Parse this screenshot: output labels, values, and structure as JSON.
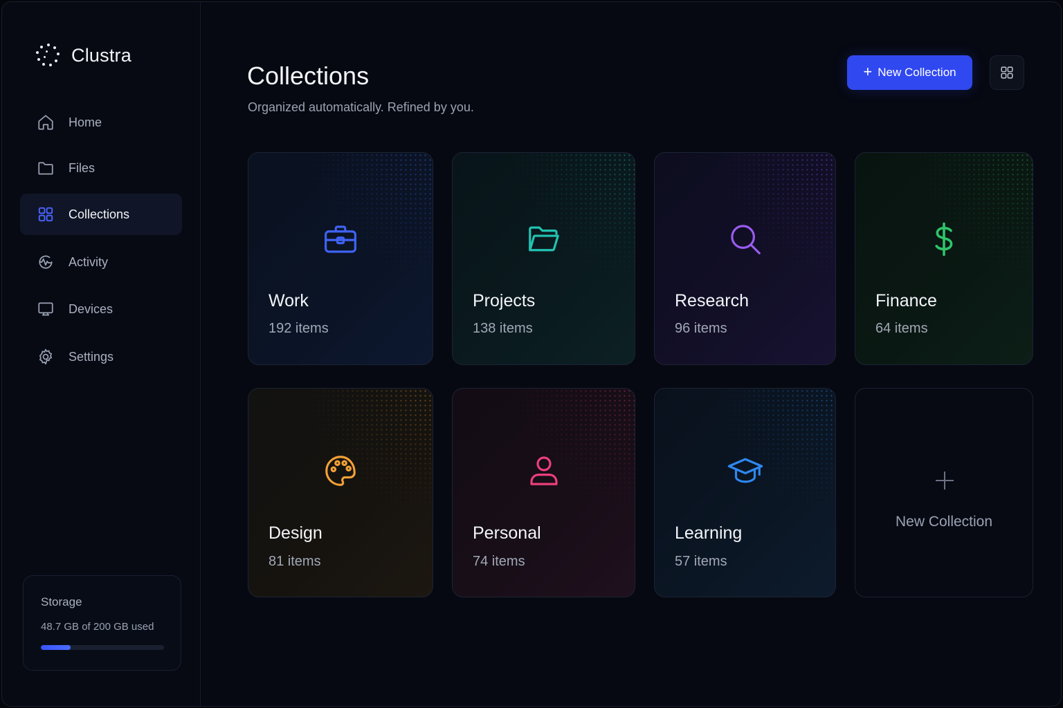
{
  "app": {
    "name": "Clustra"
  },
  "sidebar": {
    "items": [
      {
        "label": "Home",
        "icon": "home-icon",
        "active": false
      },
      {
        "label": "Files",
        "icon": "folder-icon",
        "active": false
      },
      {
        "label": "Collections",
        "icon": "grid-icon",
        "active": true
      },
      {
        "label": "Activity",
        "icon": "activity-icon",
        "active": false
      },
      {
        "label": "Devices",
        "icon": "monitor-icon",
        "active": false
      },
      {
        "label": "Settings",
        "icon": "gear-icon",
        "active": false
      }
    ],
    "storage": {
      "title": "Storage",
      "used_text": "48.7 GB of 200 GB used",
      "used_fraction": 0.2435
    }
  },
  "header": {
    "title": "Collections",
    "subtitle": "Organized automatically. Refined by you.",
    "new_button_label": "New Collection",
    "view_toggle_icon": "grid-view-icon"
  },
  "collections": [
    {
      "name": "Work",
      "count": "192 items",
      "icon": "briefcase-icon",
      "color": "#3f63f5"
    },
    {
      "name": "Projects",
      "count": "138 items",
      "icon": "folder-open-icon",
      "color": "#22c3b4"
    },
    {
      "name": "Research",
      "count": "96 items",
      "icon": "search-icon",
      "color": "#9a5cf0"
    },
    {
      "name": "Finance",
      "count": "64 items",
      "icon": "dollar-icon",
      "color": "#2fc46a"
    },
    {
      "name": "Design",
      "count": "81 items",
      "icon": "palette-icon",
      "color": "#f2a037"
    },
    {
      "name": "Personal",
      "count": "74 items",
      "icon": "user-icon",
      "color": "#ec3f7c"
    },
    {
      "name": "Learning",
      "count": "57 items",
      "icon": "graduation-cap-icon",
      "color": "#2f88f0"
    }
  ],
  "new_collection_card": {
    "label": "New Collection",
    "icon": "plus-icon"
  },
  "colors": {
    "accent": "#3048f0",
    "background": "#060911"
  }
}
